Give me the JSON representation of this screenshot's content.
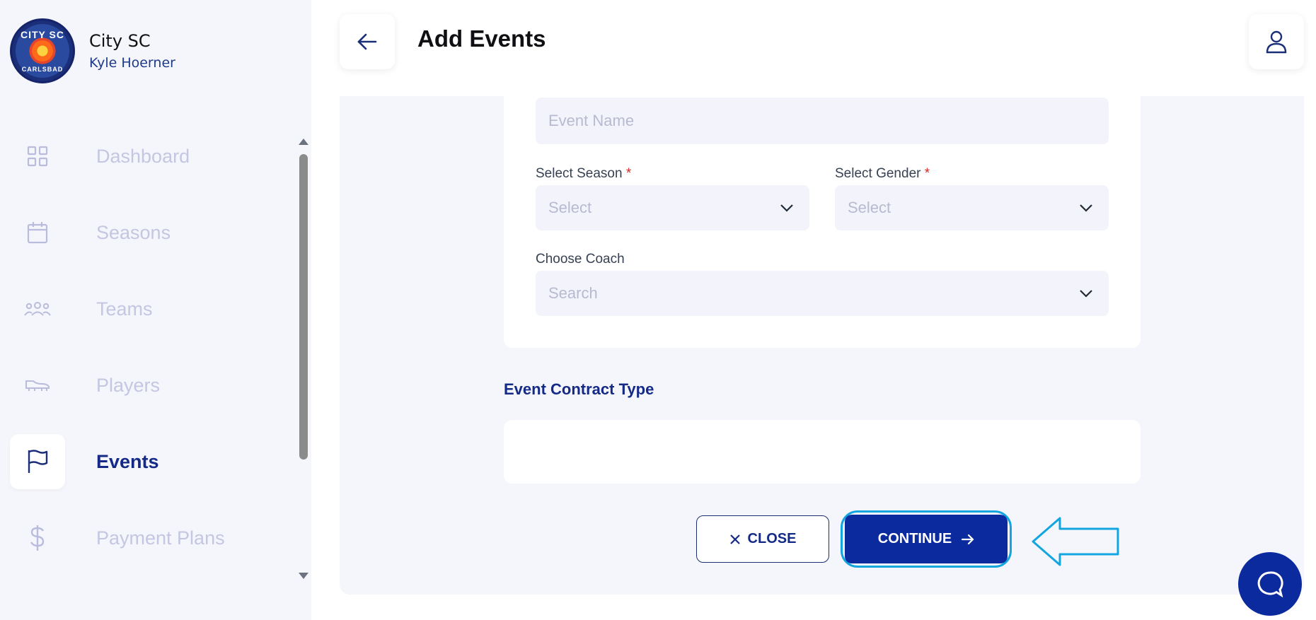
{
  "brand": {
    "name": "City SC",
    "user": "Kyle Hoerner",
    "logo_text_top": "CITY SC",
    "logo_text_bottom": "CARLSBAD"
  },
  "nav": {
    "items": [
      {
        "label": "Dashboard",
        "icon": "grid-icon",
        "active": false
      },
      {
        "label": "Seasons",
        "icon": "calendar-icon",
        "active": false
      },
      {
        "label": "Teams",
        "icon": "people-icon",
        "active": false
      },
      {
        "label": "Players",
        "icon": "cleat-icon",
        "active": false
      },
      {
        "label": "Events",
        "icon": "flag-icon",
        "active": true
      },
      {
        "label": "Payment Plans",
        "icon": "dollar-icon",
        "active": false
      }
    ]
  },
  "header": {
    "title": "Add Events"
  },
  "form": {
    "event_name_placeholder": "Event Name",
    "season_label": "Select Season",
    "season_placeholder": "Select",
    "gender_label": "Select Gender",
    "gender_placeholder": "Select",
    "required_mark": "*",
    "coach_label": "Choose Coach",
    "coach_placeholder": "Search"
  },
  "contract": {
    "title": "Event Contract Type"
  },
  "actions": {
    "close_label": "CLOSE",
    "continue_label": "CONTINUE"
  },
  "colors": {
    "primary": "#0a2a9e",
    "annotation": "#12a5e0",
    "sidebar_bg": "#f5f6fb",
    "nav_inactive": "#c4c6e2"
  }
}
